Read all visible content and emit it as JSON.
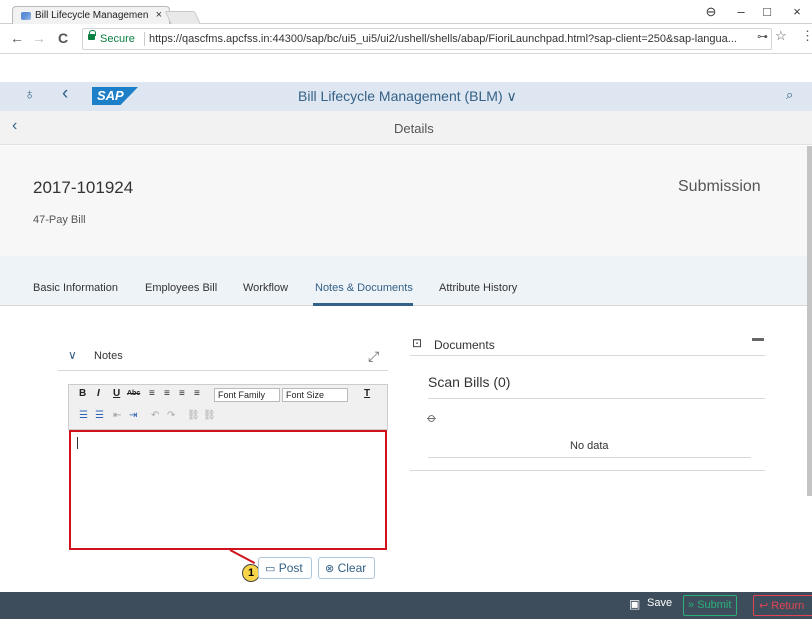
{
  "browser": {
    "tab_title": "Bill Lifecycle Managemen",
    "tab_close": "×",
    "win_min": "–",
    "win_max": "□",
    "win_close": "×",
    "user_glyph": "⊖",
    "back": "←",
    "forward": "→",
    "reload": "C",
    "secure": "Secure",
    "url": "https://qascfms.apcfss.in:44300/sap/bc/ui5_ui5/ui2/ushell/shells/abap/FioriLaunchpad.html?sap-client=250&sap-langua...",
    "key_glyph": "⊶",
    "star_glyph": "☆",
    "menu_glyph": "⋮"
  },
  "shell": {
    "person_glyph": "♁",
    "back_glyph": "‹",
    "logo": "SAP",
    "title": "Bill Lifecycle Management (BLM) ∨",
    "search_glyph": "⌕"
  },
  "subheader": {
    "back_glyph": "‹",
    "title": "Details"
  },
  "object": {
    "number": "2017-101924",
    "subtitle": "47-Pay Bill",
    "status": "Submission"
  },
  "tabs": [
    {
      "label": "Basic Information"
    },
    {
      "label": "Employees Bill"
    },
    {
      "label": "Workflow"
    },
    {
      "label": "Notes & Documents"
    },
    {
      "label": "Attribute History"
    }
  ],
  "notes": {
    "chevron": "∨",
    "title": "Notes",
    "expand_glyph": "⤢",
    "toolbar": {
      "bold": "B",
      "italic": "I",
      "underline": "U",
      "strike": "Abc",
      "align_left": "≡",
      "align_center": "≡",
      "align_right": "≡",
      "justify": "≡",
      "font_family": "Font Family",
      "font_size": "Font Size",
      "text_color": "T",
      "list_bullet": "☰",
      "list_number": "☰",
      "outdent": "⇤",
      "indent": "⇥",
      "undo": "↶",
      "redo": "↷",
      "link": "⛓",
      "unlink": "⛓"
    },
    "post_label": "Post",
    "clear_label": "Clear",
    "callout": "1"
  },
  "documents": {
    "title": "Documents",
    "section": "Scan Bills (0)",
    "empty": "No data"
  },
  "footer": {
    "save": "Save",
    "submit": "Submit",
    "return": "Return"
  },
  "colors": {
    "shell_bg": "#dee7f1",
    "accent": "#346187",
    "footer_bg": "#3d4d5c",
    "highlight": "#d0121d",
    "submit": "#2bb07a",
    "return": "#e34352"
  }
}
